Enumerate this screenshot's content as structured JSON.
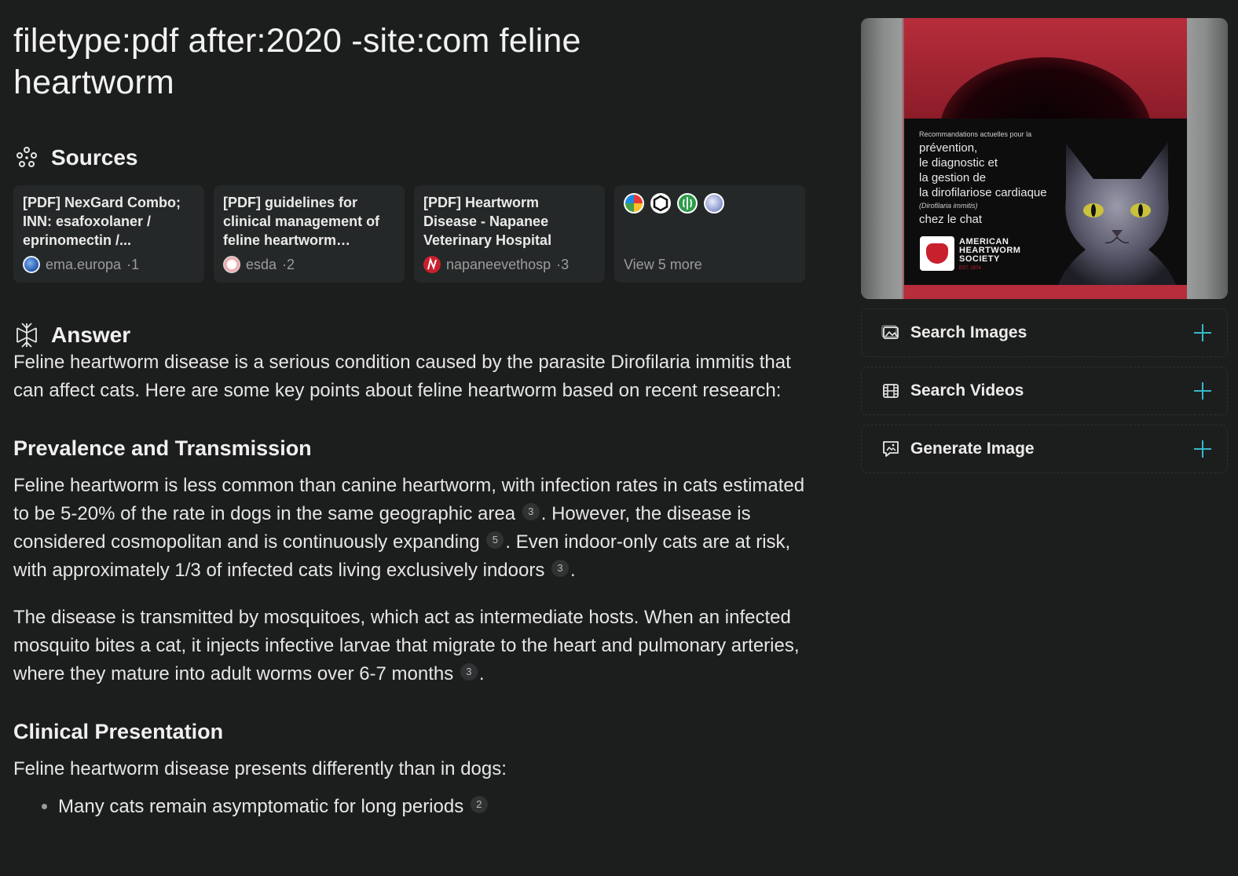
{
  "query": "filetype:pdf after:2020 -site:com feline heartworm",
  "sources_section": {
    "label": "Sources",
    "items": [
      {
        "title": "[PDF] NexGard Combo; INN: esafoxolaner / eprinomectin /...",
        "domain": "ema.europa",
        "index": "1"
      },
      {
        "title": "[PDF] guidelines for clinical management of feline heartworm diseas...",
        "domain": "esda",
        "index": "2"
      },
      {
        "title": "[PDF] Heartworm Disease - Napanee Veterinary Hospital",
        "domain": "napaneevethosp",
        "index": "3"
      }
    ],
    "more_label": "View 5 more",
    "separator": " · "
  },
  "answer_section": {
    "label": "Answer",
    "intro": "Feline heartworm disease is a serious condition caused by the parasite Dirofilaria immitis that can affect cats. Here are some key points about feline heartworm based on recent research:",
    "prevalence": {
      "heading": "Prevalence and Transmission",
      "p1_a": "Feline heartworm is less common than canine heartworm, with infection rates in cats estimated to be 5-20% of the rate in dogs in the same geographic area",
      "p1_cite1": "3",
      "p1_b": ". However, the disease is considered cosmopolitan and is continuously expanding",
      "p1_cite2": "5",
      "p1_c": ". Even indoor-only cats are at risk, with approximately 1/3 of infected cats living exclusively indoors",
      "p1_cite3": "3",
      "p1_d": ".",
      "p2_a": "The disease is transmitted by mosquitoes, which act as intermediate hosts. When an infected mosquito bites a cat, it injects infective larvae that migrate to the heart and pulmonary arteries, where they mature into adult worms over 6-7 months",
      "p2_cite": "3",
      "p2_b": "."
    },
    "clinical": {
      "heading": "Clinical Presentation",
      "intro": "Feline heartworm disease presents differently than in dogs:",
      "bullet1": "Many cats remain asymptomatic for long periods",
      "bullet1_cite": "2"
    }
  },
  "sidebar": {
    "poster": {
      "kicker": "Recommandations actuelles pour la",
      "line1": "prévention,",
      "line2": "le diagnostic et",
      "line3": "la gestion de",
      "line4": "la dirofilariose cardiaque",
      "latin": "(Dirofilaria immitis)",
      "line5": "chez le chat",
      "org1": "AMERICAN",
      "org2": "HEARTWORM",
      "org3": "SOCIETY",
      "est": "EST. 1974"
    },
    "actions": [
      {
        "label": "Search Images",
        "icon": "image-icon"
      },
      {
        "label": "Search Videos",
        "icon": "film-icon"
      },
      {
        "label": "Generate Image",
        "icon": "generate-image-icon"
      }
    ]
  },
  "colors": {
    "accent": "#35b8c9",
    "background": "#1c1e1e",
    "card": "#252828"
  }
}
